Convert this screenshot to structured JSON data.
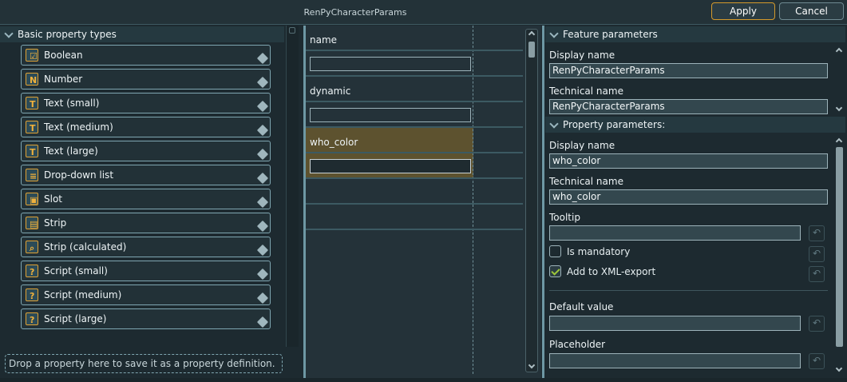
{
  "window": {
    "title": "RenPyCharacterParams"
  },
  "buttons": {
    "apply": "Apply",
    "cancel": "Cancel"
  },
  "left_panel": {
    "header": "Basic property types",
    "items": [
      {
        "label": "Boolean",
        "icon": "boolean-icon",
        "glyph": "☑"
      },
      {
        "label": "Number",
        "icon": "number-icon",
        "glyph": "N"
      },
      {
        "label": "Text (small)",
        "icon": "text-small-icon",
        "glyph": "T"
      },
      {
        "label": "Text (medium)",
        "icon": "text-medium-icon",
        "glyph": "T"
      },
      {
        "label": "Text (large)",
        "icon": "text-large-icon",
        "glyph": "T"
      },
      {
        "label": "Drop-down list",
        "icon": "dropdown-list-icon",
        "glyph": "≡"
      },
      {
        "label": "Slot",
        "icon": "slot-icon",
        "glyph": "▣"
      },
      {
        "label": "Strip",
        "icon": "strip-icon",
        "glyph": "▤"
      },
      {
        "label": "Strip (calculated)",
        "icon": "strip-calculated-icon",
        "glyph": "⌕"
      },
      {
        "label": "Script (small)",
        "icon": "script-small-icon",
        "glyph": "?"
      },
      {
        "label": "Script (medium)",
        "icon": "script-medium-icon",
        "glyph": "?"
      },
      {
        "label": "Script (large)",
        "icon": "script-large-icon",
        "glyph": "?"
      }
    ],
    "dropzone": "Drop a property here to save it as a property definition."
  },
  "middle_panel": {
    "rows": [
      {
        "label": "name",
        "value": ""
      },
      {
        "label": "dynamic",
        "value": ""
      },
      {
        "label": "who_color",
        "value": "",
        "selected": true
      }
    ]
  },
  "right_panel": {
    "feature_header": "Feature parameters",
    "feature": {
      "display_name_label": "Display name",
      "display_name": "RenPyCharacterParams",
      "technical_name_label": "Technical name",
      "technical_name": "RenPyCharacterParams"
    },
    "property_header": "Property parameters:",
    "property": {
      "display_name_label": "Display name",
      "display_name": "who_color",
      "technical_name_label": "Technical name",
      "technical_name": "who_color",
      "tooltip_label": "Tooltip",
      "tooltip": "",
      "is_mandatory_label": "Is mandatory",
      "is_mandatory": false,
      "xml_export_label": "Add to XML-export",
      "xml_export": true,
      "default_value_label": "Default value",
      "default_value": "",
      "placeholder_label": "Placeholder",
      "placeholder": ""
    }
  },
  "colors": {
    "accent": "#d49a2c",
    "selection": "#5d522f",
    "check": "#9dc63b"
  }
}
